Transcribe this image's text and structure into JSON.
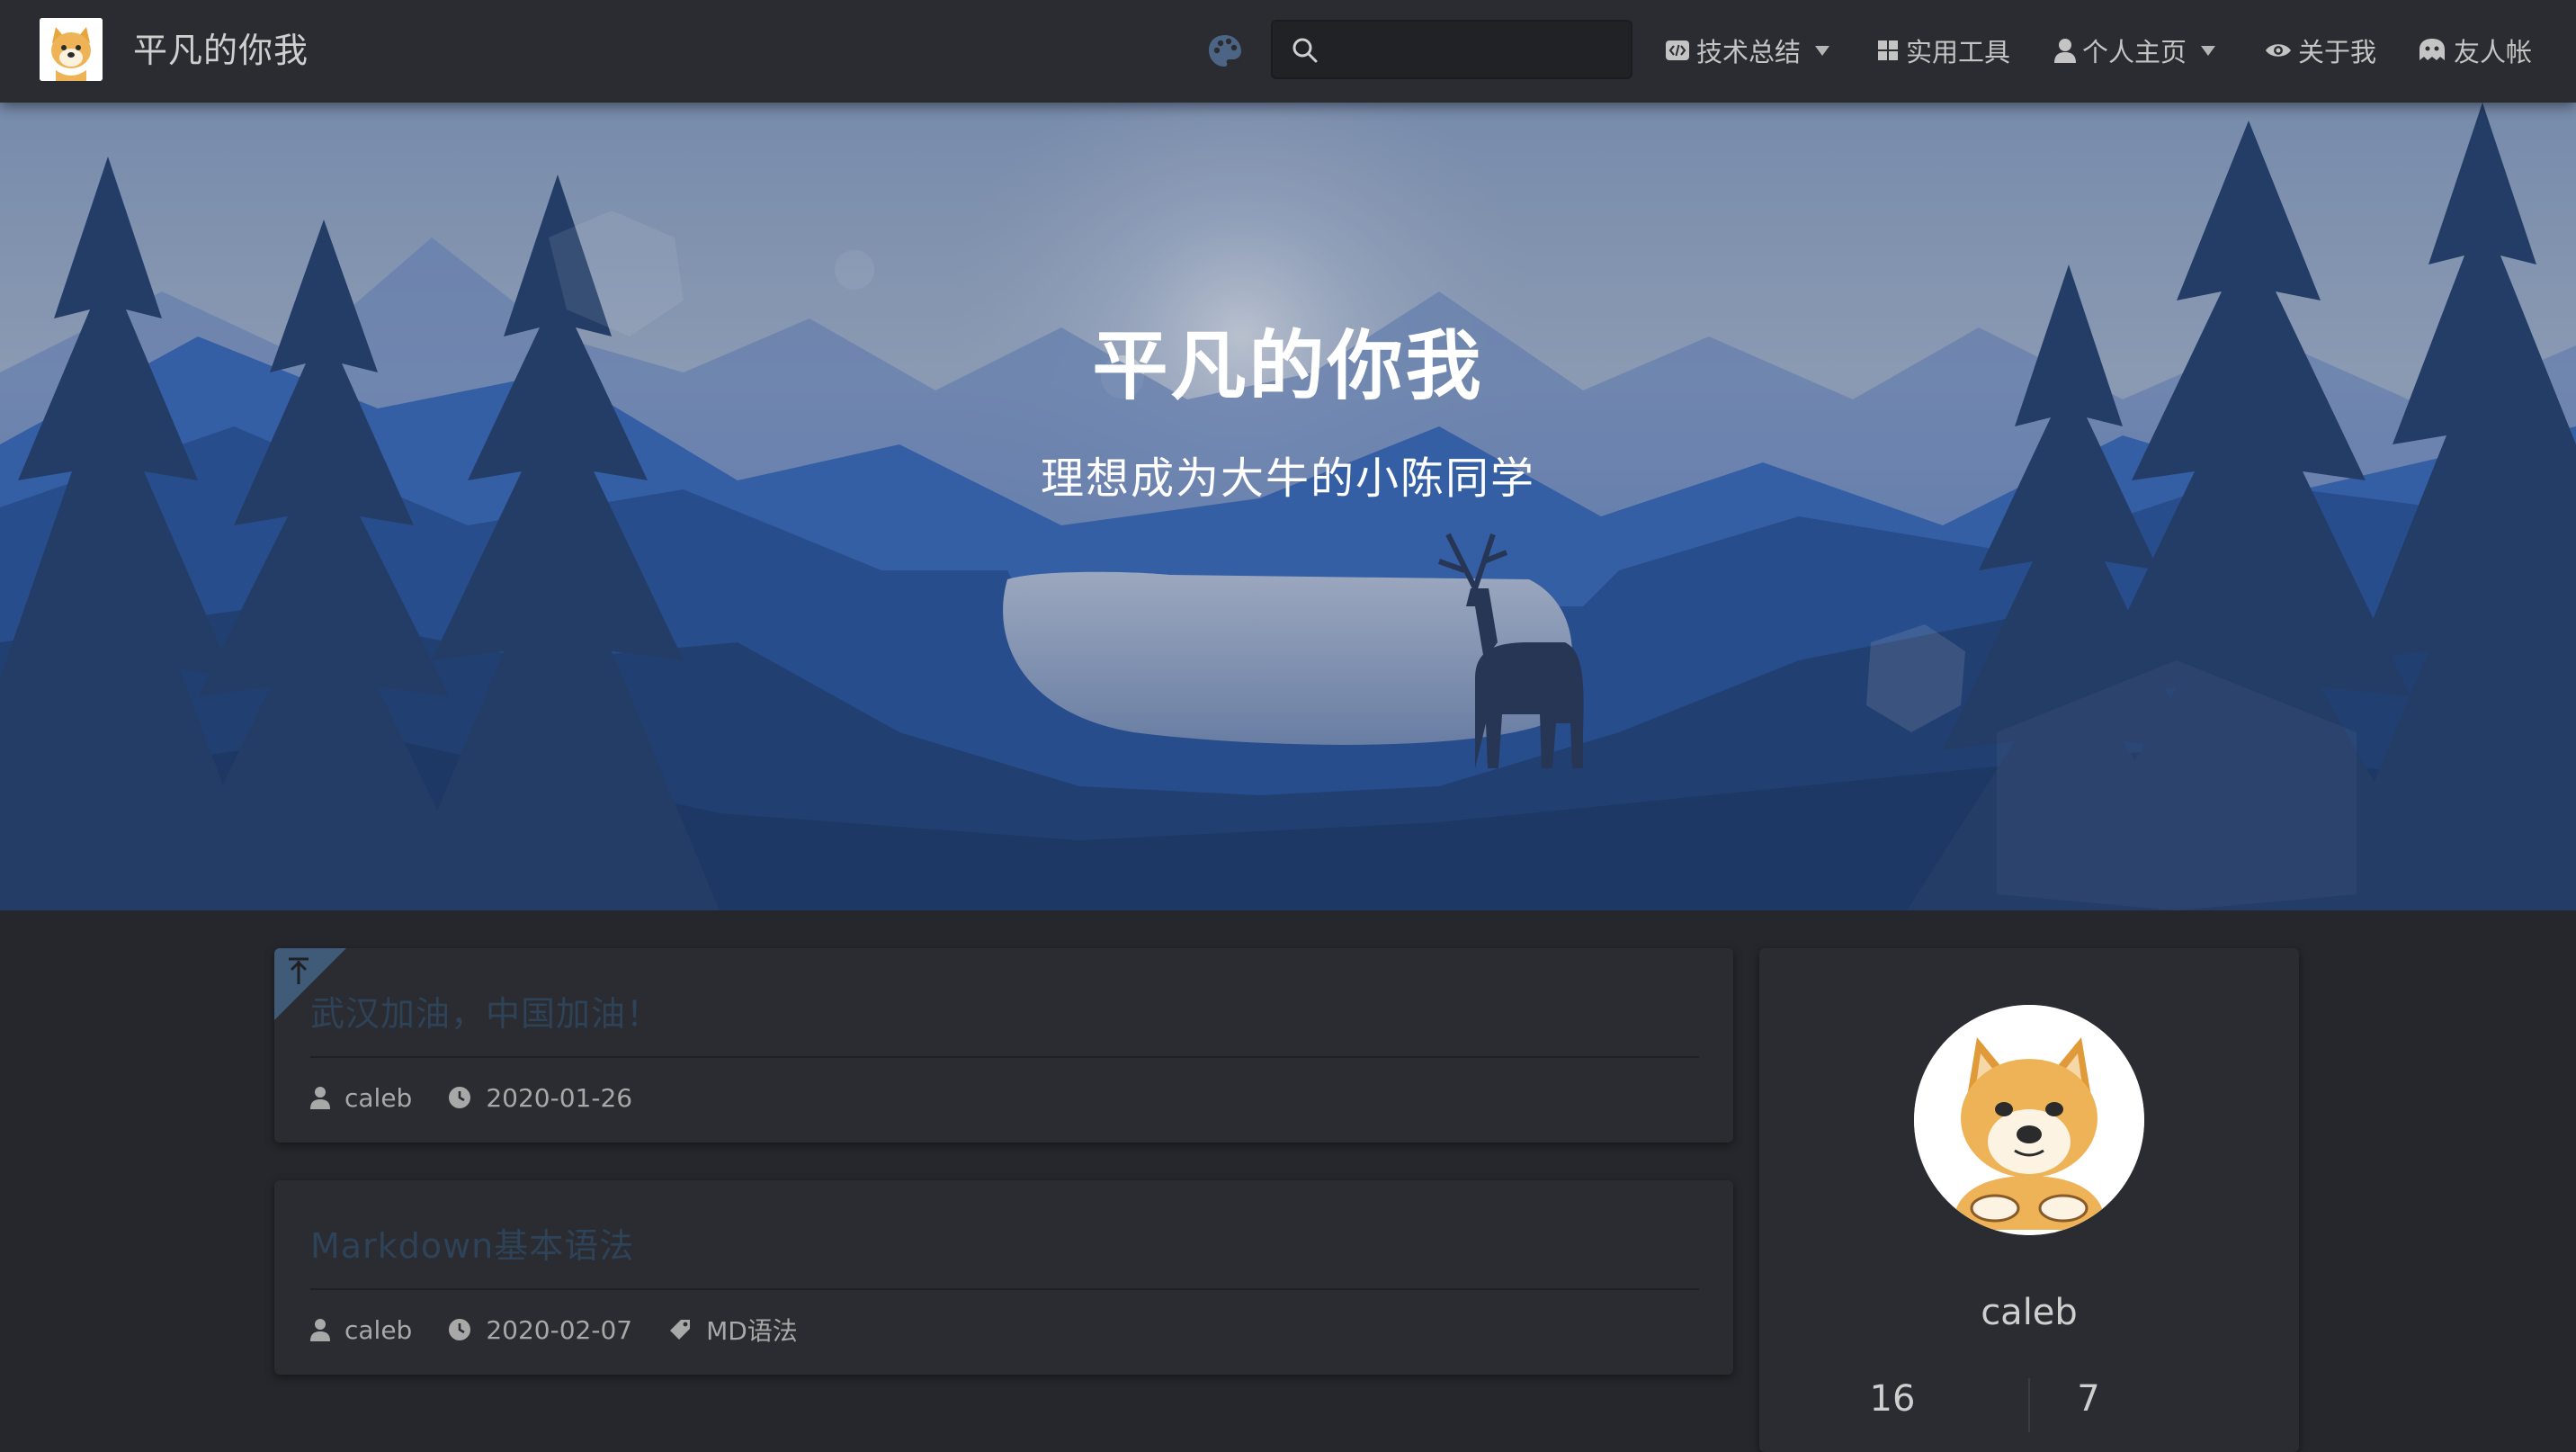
{
  "site": {
    "title": "平凡的你我",
    "logo_icon": "doge-avatar-icon"
  },
  "search": {
    "placeholder": "",
    "value": ""
  },
  "nav": {
    "items": [
      {
        "label": "技术总结",
        "icon": "code-icon",
        "dropdown": true
      },
      {
        "label": "实用工具",
        "icon": "grid-icon",
        "dropdown": false
      },
      {
        "label": "个人主页",
        "icon": "user-icon",
        "dropdown": true
      },
      {
        "label": "关于我",
        "icon": "eye-icon",
        "dropdown": false
      },
      {
        "label": "友人帐",
        "icon": "ghost-icon",
        "dropdown": false
      }
    ]
  },
  "hero": {
    "title": "平凡的你我",
    "subtitle": "理想成为大牛的小陈同学"
  },
  "posts": [
    {
      "title": "武汉加油，中国加油！",
      "author": "caleb",
      "date": "2020-01-26",
      "pinned": true,
      "tag": ""
    },
    {
      "title": "Markdown基本语法",
      "author": "caleb",
      "date": "2020-02-07",
      "pinned": false,
      "tag": "MD语法"
    }
  ],
  "profile": {
    "name": "caleb",
    "stats": [
      "16",
      "7"
    ]
  },
  "colors": {
    "background": "#25272c",
    "navbar": "#2a2c31",
    "card": "#2a2c31",
    "post_title": "#2e4258",
    "ribbon": "#3f5b78"
  }
}
